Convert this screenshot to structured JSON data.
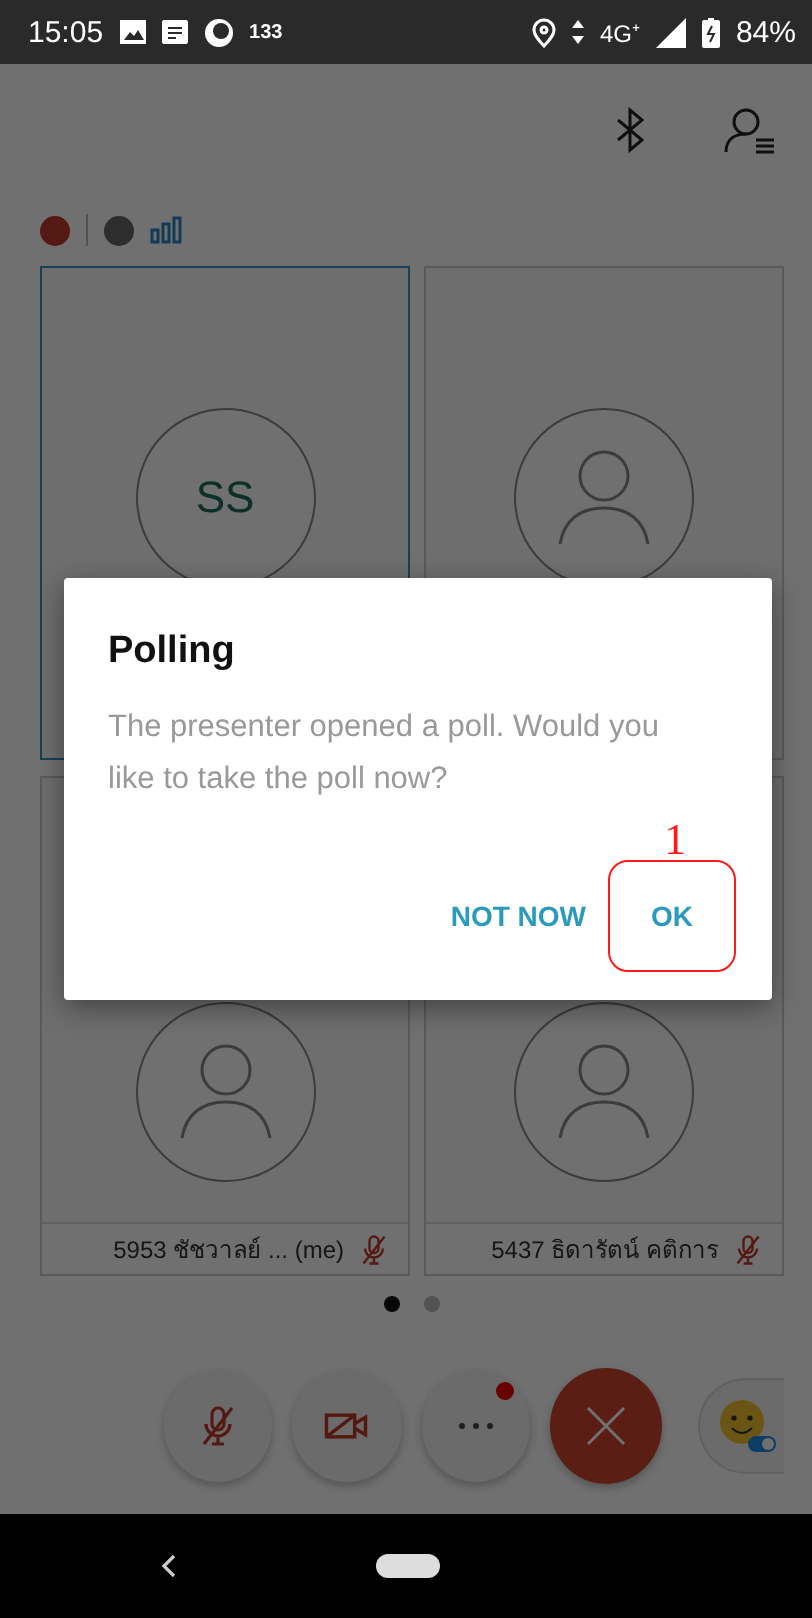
{
  "status_bar": {
    "time": "15:05",
    "notification_count": "133",
    "network": "4G⁺",
    "battery": "84%"
  },
  "toolbar": {
    "icons": [
      {
        "kind": "bluetooth"
      },
      {
        "kind": "participants"
      }
    ]
  },
  "indicators": [
    {
      "kind": "mic"
    },
    {
      "kind": "presenter"
    },
    {
      "kind": "signal"
    }
  ],
  "tiles": [
    {
      "kind": "initials",
      "initials": "SS",
      "selected": true
    },
    {
      "kind": "avatar",
      "selected": false
    },
    {
      "kind": "avatar",
      "name": "5953 ชัชวาลย์ ... (me)",
      "muted": true,
      "selected": false
    },
    {
      "kind": "avatar",
      "name": "5437 ธิดารัตน์ คติการ",
      "muted": true,
      "selected": false
    }
  ],
  "pages": [
    {
      "selected": true
    },
    {
      "selected": false
    }
  ],
  "controls": [
    {
      "kind": "mute"
    },
    {
      "kind": "video"
    },
    {
      "kind": "more",
      "badge": true
    },
    {
      "kind": "end"
    },
    {
      "kind": "reactions"
    }
  ],
  "dialog": {
    "title": "Polling",
    "message": "The presenter opened a poll. Would you like to take the poll now?",
    "buttons": [
      {
        "label": "NOT NOW",
        "highlighted": false
      },
      {
        "label": "OK",
        "highlighted": true
      }
    ]
  },
  "annotation": {
    "label": "1"
  }
}
